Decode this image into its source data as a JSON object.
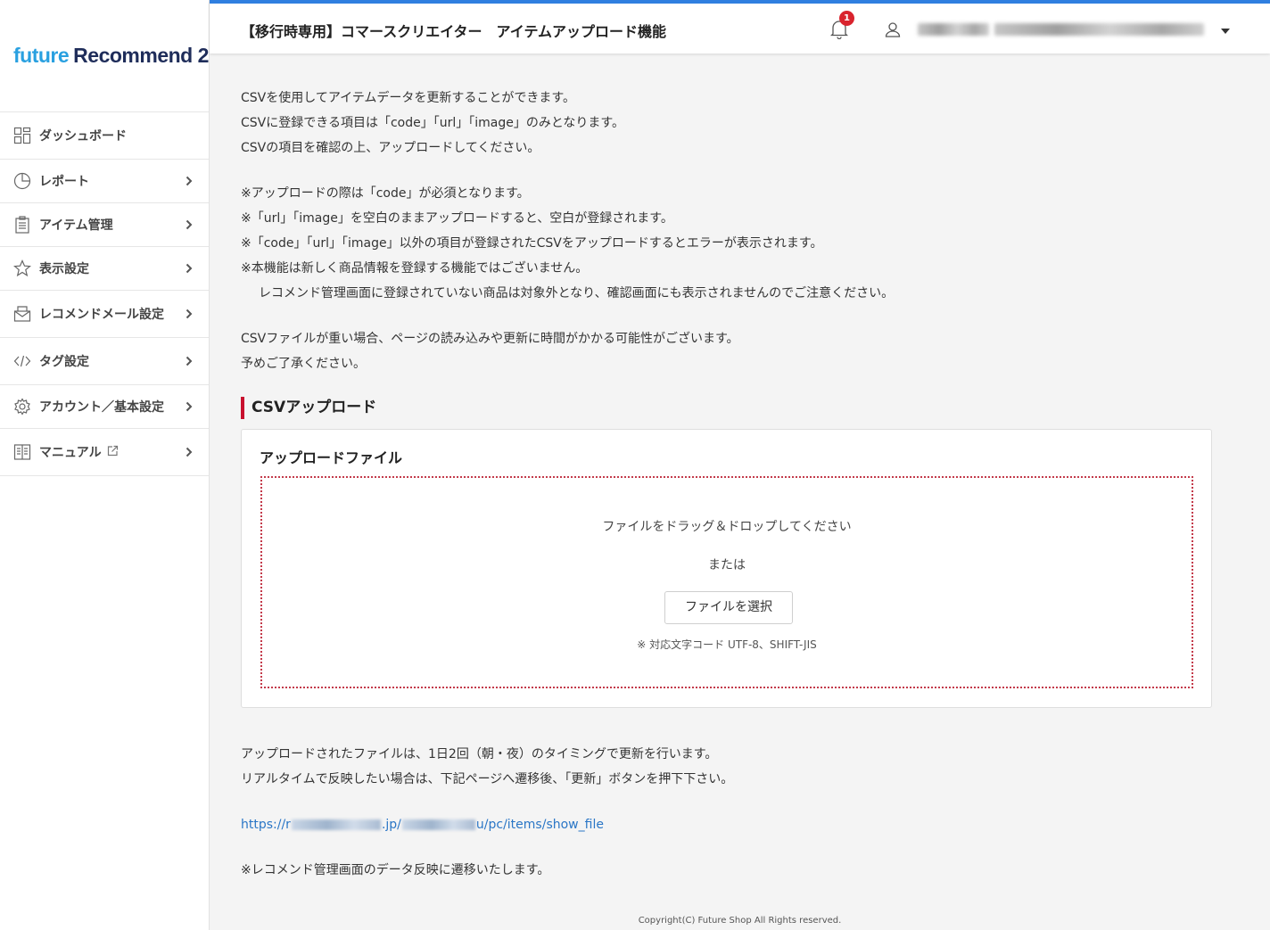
{
  "logo": {
    "part1": "future",
    "part2": "Recommend 2"
  },
  "sidebar": {
    "items": [
      {
        "label": "ダッシュボード",
        "icon": "dashboard-grid-icon"
      },
      {
        "label": "レポート",
        "icon": "pie-chart-icon"
      },
      {
        "label": "アイテム管理",
        "icon": "clipboard-icon"
      },
      {
        "label": "表示設定",
        "icon": "star-icon"
      },
      {
        "label": "レコメンドメール設定",
        "icon": "mail-icon"
      },
      {
        "label": "タグ設定",
        "icon": "code-icon"
      },
      {
        "label": "アカウント／基本設定",
        "icon": "gear-icon"
      },
      {
        "label": "マニュアル",
        "icon": "book-icon",
        "external": "external-link-icon"
      }
    ]
  },
  "header": {
    "title": "【移行時専用】コマースクリエイター　アイテムアップロード機能",
    "notification_count": "1"
  },
  "intro": {
    "lines": [
      "CSVを使用してアイテムデータを更新することができます。",
      "CSVに登録できる項目は「code」「url」「image」のみとなります。",
      "CSVの項目を確認の上、アップロードしてください。"
    ],
    "notes": [
      "※アップロードの際は「code」が必須となります。",
      "※「url」「image」を空白のままアップロードすると、空白が登録されます。",
      "※「code」「url」「image」以外の項目が登録されたCSVをアップロードするとエラーが表示されます。",
      "※本機能は新しく商品情報を登録する機能ではございません。",
      "レコメンド管理画面に登録されていない商品は対象外となり、確認画面にも表示されませんのでご注意ください。"
    ],
    "heavy": [
      "CSVファイルが重い場合、ページの読み込みや更新に時間がかかる可能性がございます。",
      "予めご了承ください。"
    ]
  },
  "upload": {
    "section_title": "CSVアップロード",
    "card_title": "アップロードファイル",
    "drop_text": "ファイルをドラッグ＆ドロップしてください",
    "or_text": "または",
    "button_label": "ファイルを選択",
    "encoding_note": "※ 対応文字コード UTF-8、SHIFT-JIS"
  },
  "bottom": {
    "lines": [
      "アップロードされたファイルは、1日2回（朝・夜）のタイミングで更新を行います。",
      "リアルタイムで反映したい場合は、下記ページへ遷移後、「更新」ボタンを押下下さい。"
    ],
    "link": {
      "prefix": "https://r",
      "middle": ".jp/",
      "suffix": "u/pc/items/show_file"
    },
    "note": "※レコメンド管理画面のデータ反映に遷移いたします。"
  },
  "footer": {
    "copyright": "Copyright(C) Future Shop All Rights reserved."
  },
  "colors": {
    "accent": "#2f7fe0",
    "brand_blue": "#29a0e0",
    "brand_navy": "#1f2d5a",
    "danger": "#c8102e",
    "link": "#2a76c6"
  }
}
